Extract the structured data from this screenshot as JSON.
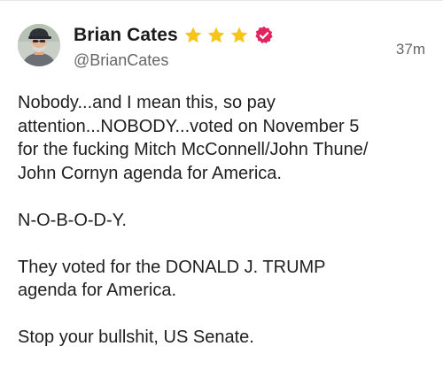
{
  "post": {
    "author": {
      "display_name": "Brian Cates",
      "handle": "@BrianCates",
      "badges": [
        "star-icon",
        "star-icon",
        "star-icon",
        "verified-badge-icon"
      ],
      "badge_colors": {
        "star": "#F5C518",
        "verified": "#E0245E"
      }
    },
    "timestamp": "37m",
    "body": {
      "paragraphs": [
        {
          "lines": [
            "Nobody...and I mean this, so pay",
            "attention...NOBODY...voted on November 5",
            "for the fucking Mitch McConnell/John Thune/",
            "John Cornyn agenda for America."
          ]
        },
        {
          "lines": [
            "N-O-B-O-D-Y."
          ]
        },
        {
          "lines": [
            "They voted for the DONALD J. TRUMP",
            "agenda for America."
          ]
        },
        {
          "lines": [
            "Stop your bullshit, US Senate."
          ]
        }
      ]
    }
  }
}
